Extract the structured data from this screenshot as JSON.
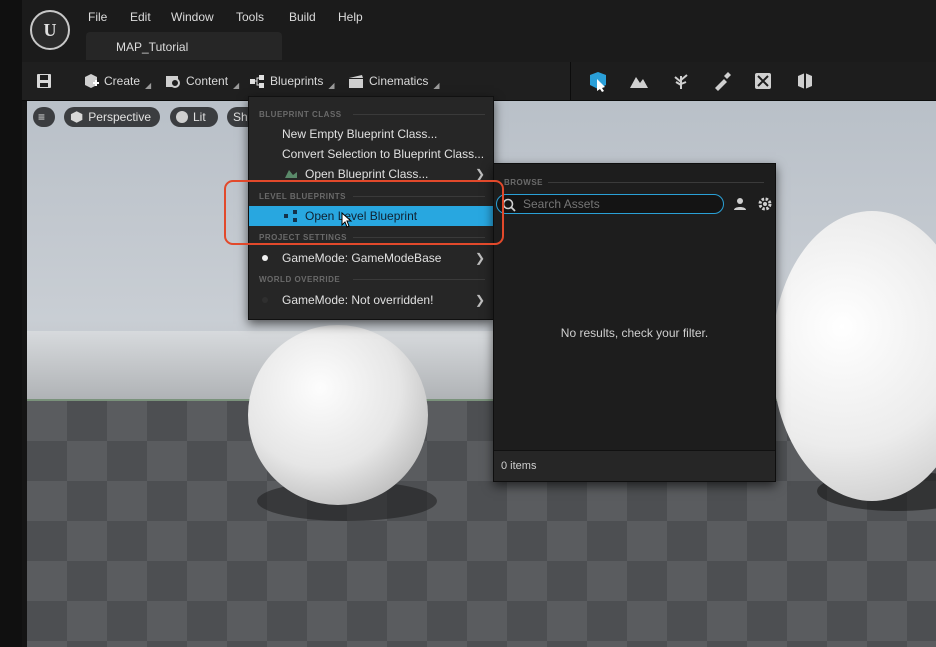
{
  "app": {
    "logo_text": "U",
    "tab_title": "MAP_Tutorial"
  },
  "menubar": [
    "File",
    "Edit",
    "Window",
    "Tools",
    "Build",
    "Help"
  ],
  "toolbar": {
    "save_icon": "floppy-disk-icon",
    "create_label": "Create",
    "content_label": "Content",
    "blueprints_label": "Blueprints",
    "cinematics_label": "Cinematics",
    "mode_icons": [
      "select-mode-icon",
      "landscape-mode-icon",
      "foliage-mode-icon",
      "mesh-paint-mode-icon",
      "fracture-mode-icon",
      "modeling-mode-icon"
    ]
  },
  "viewport": {
    "menu_icon": "hamburger-icon",
    "perspective_label": "Perspective",
    "lit_label": "Lit",
    "show_label_partial": "Sh"
  },
  "blueprint_menu": {
    "section_blueprint_class": "BLUEPRINT CLASS",
    "new_empty": "New Empty Blueprint Class...",
    "convert_selection": "Convert Selection to Blueprint Class...",
    "open_blueprint_class": "Open Blueprint Class...",
    "section_level_blueprints": "LEVEL BLUEPRINTS",
    "open_level_blueprint": "Open Level Blueprint",
    "section_project_settings": "PROJECT SETTINGS",
    "gamemode_project": "GameMode: GameModeBase",
    "section_world_override": "WORLD OVERRIDE",
    "gamemode_world": "GameMode: Not overridden!"
  },
  "asset_picker": {
    "section_browse": "BROWSE",
    "search_placeholder": "Search Assets",
    "empty_message": "No results, check your filter.",
    "item_count": "0 items"
  },
  "colors": {
    "accent": "#28a7e0",
    "highlight_box": "#e2492b"
  }
}
